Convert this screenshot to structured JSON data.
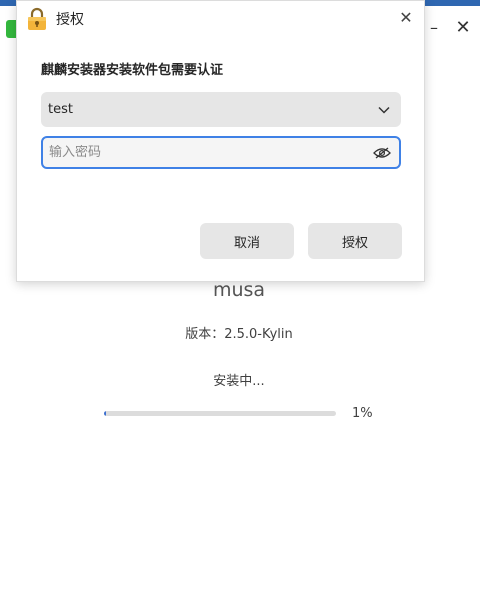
{
  "installer": {
    "app_name": "musa",
    "version": "版本：2.5.0-Kylin",
    "status": "安装中...",
    "progress_percent": 1,
    "progress_text": "1%",
    "accent_color": "#2f67b1"
  },
  "dialog": {
    "title": "授权",
    "heading": "麒麟安装器安装软件包需要认证",
    "user_select_value": "test",
    "password_placeholder": "输入密码",
    "password_value": "",
    "cancel_label": "取消",
    "authorize_label": "授权",
    "focus_color": "#3f81e6"
  },
  "icons": {
    "dialog": "lock-icon",
    "close": "close-icon",
    "dropdown": "chevron-down-icon",
    "visibility": "eye-off-icon",
    "window_minimize": "minimize-icon",
    "window_close": "close-icon"
  }
}
